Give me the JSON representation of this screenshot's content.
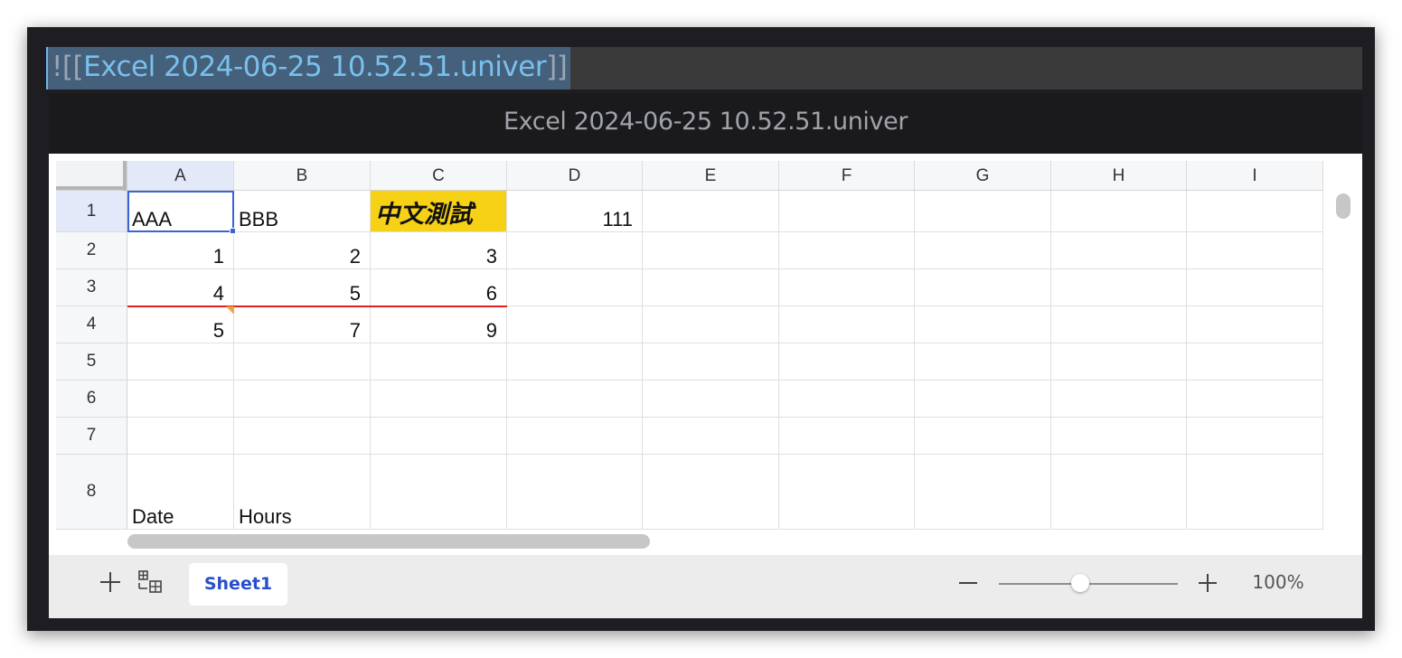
{
  "embed": {
    "prefix": "![[",
    "name": "Excel 2024-06-25 10.52.51.univer",
    "suffix": "]]"
  },
  "file_title": "Excel 2024-06-25 10.52.51.univer",
  "columns": [
    "A",
    "B",
    "C",
    "D",
    "E",
    "F",
    "G",
    "H",
    "I"
  ],
  "rows": [
    "1",
    "2",
    "3",
    "4",
    "5",
    "6",
    "7",
    "8"
  ],
  "cells": {
    "A1": "AAA",
    "B1": "BBB",
    "C1": "中文測試",
    "D1": "111",
    "A2": "1",
    "B2": "2",
    "C2": "3",
    "A3": "4",
    "B3": "5",
    "C3": "6",
    "A4": "5",
    "B4": "7",
    "C4": "9",
    "A8": "Date",
    "B8": "Hours"
  },
  "styles": {
    "highlight_fill": "#f7d116",
    "selection_color": "#3a64d6",
    "border_red": "#e02020",
    "comment_marker": "#f2a541"
  },
  "selected_cell": "A1",
  "footer": {
    "sheet_tab": "Sheet1",
    "zoom_value": "100%",
    "zoom_level": 1.0,
    "icons": [
      "plus-icon",
      "sheet-list-icon",
      "minus-icon",
      "plus-icon"
    ]
  }
}
